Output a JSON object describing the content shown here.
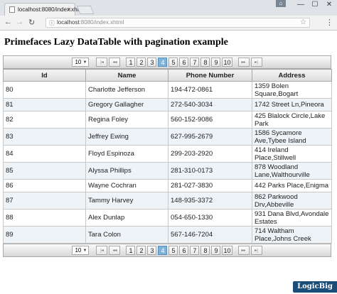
{
  "browser": {
    "tab_title": "localhost:8080/index.xhtml",
    "tab_close": "×",
    "url_host": "localhost",
    "url_rest": ":8080/index.xhtml",
    "window_buttons": [
      "—",
      "☐",
      "✕"
    ]
  },
  "page": {
    "title": "Primefaces Lazy DataTable with pagination example"
  },
  "pager": {
    "rows_per_page": "10",
    "first": "|◂",
    "prev": "◂◂",
    "next": "▸▸",
    "last": "▸|",
    "pages": [
      "1",
      "2",
      "3",
      "4",
      "5",
      "6",
      "7",
      "8",
      "9",
      "10"
    ],
    "current_page": "4"
  },
  "table": {
    "headers": [
      "Id",
      "Name",
      "Phone Number",
      "Address"
    ],
    "rows": [
      {
        "id": "80",
        "name": "Charlotte Jefferson",
        "phone": "194-472-0861",
        "address": "1359 Bolen Square,Bogart"
      },
      {
        "id": "81",
        "name": "Gregory Gallagher",
        "phone": "272-540-3034",
        "address": "1742 Street Ln,Pineora"
      },
      {
        "id": "82",
        "name": "Regina Foley",
        "phone": "560-152-9086",
        "address": "425 Blalock Circle,Lake Park"
      },
      {
        "id": "83",
        "name": "Jeffrey Ewing",
        "phone": "627-995-2679",
        "address": "1586 Sycamore Ave,Tybee Island"
      },
      {
        "id": "84",
        "name": "Floyd Espinoza",
        "phone": "299-203-2920",
        "address": "414 Ireland Place,Stillwell"
      },
      {
        "id": "85",
        "name": "Alyssa Phillips",
        "phone": "281-310-0173",
        "address": "878 Woodland Lane,Walthourville"
      },
      {
        "id": "86",
        "name": "Wayne Cochran",
        "phone": "281-027-3830",
        "address": "442 Parks Place,Enigma"
      },
      {
        "id": "87",
        "name": "Tammy Harvey",
        "phone": "148-935-3372",
        "address": "862 Parkwood Drv,Abbeville"
      },
      {
        "id": "88",
        "name": "Alex Dunlap",
        "phone": "054-650-1330",
        "address": "931 Dana Blvd,Avondale Estates"
      },
      {
        "id": "89",
        "name": "Tara Colon",
        "phone": "567-146-7204",
        "address": "714 Waltham Place,Johns Creek"
      }
    ]
  },
  "watermark": "LogicBig"
}
